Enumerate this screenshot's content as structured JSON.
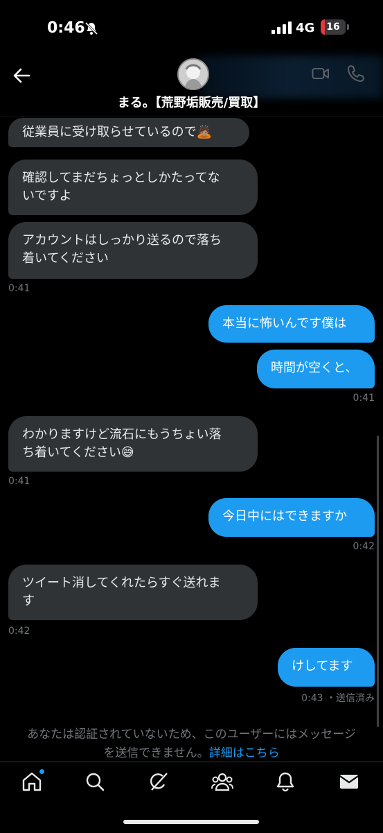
{
  "status_bar": {
    "time": "0:46",
    "network": "4G",
    "battery": "16",
    "battery_level": 0.16
  },
  "header": {
    "back_icon": "back-arrow-icon",
    "avatar_icon": "user-avatar",
    "title": "まる。【荒野垢販売/買取】",
    "video_icon": "video-call-icon",
    "phone_icon": "phone-icon"
  },
  "messages": [
    {
      "side": "in",
      "line1": "従業員に受け取らせているので🙇🏽",
      "line2": ""
    },
    {
      "side": "in",
      "line1": "確認してまだちょっとしかたってな",
      "line2": "いですよ"
    },
    {
      "side": "in",
      "line1": "アカウントはしっかり送るので落ち",
      "line2": "着いてください",
      "time": "0:41"
    },
    {
      "side": "out",
      "line1": "本当に怖いんです僕は",
      "line2": ""
    },
    {
      "side": "out",
      "line1": "時間が空くと、",
      "line2": "",
      "time": "0:41"
    },
    {
      "side": "in",
      "line1": "わかりますけど流石にもうちょい落",
      "line2": "ち着いてください😅",
      "time": "0:41"
    },
    {
      "side": "out",
      "line1": "今日中にはできますか",
      "line2": "",
      "time": "0:42"
    },
    {
      "side": "in",
      "line1": "ツイート消してくれたらすぐ送れま",
      "line2": "す",
      "time": "0:42"
    },
    {
      "side": "out",
      "line1": "けしてます",
      "line2": "",
      "time": "0:43",
      "status": "・送信済み"
    }
  ],
  "notice": {
    "line1": "あなたは認証されていないため、このユーザーにはメッセージ",
    "line2": "を送信できません。",
    "link": "詳細はこちら"
  },
  "tabbar": [
    {
      "icon": "home-icon",
      "has_dot": true
    },
    {
      "icon": "search-icon"
    },
    {
      "icon": "grok-icon"
    },
    {
      "icon": "communities-icon"
    },
    {
      "icon": "notifications-bell-icon"
    },
    {
      "icon": "messages-envelope-icon"
    }
  ],
  "colors": {
    "accent": "#1d9bf0",
    "incoming_bubble": "#2f3336",
    "background": "#000000",
    "muted": "#71767b"
  }
}
